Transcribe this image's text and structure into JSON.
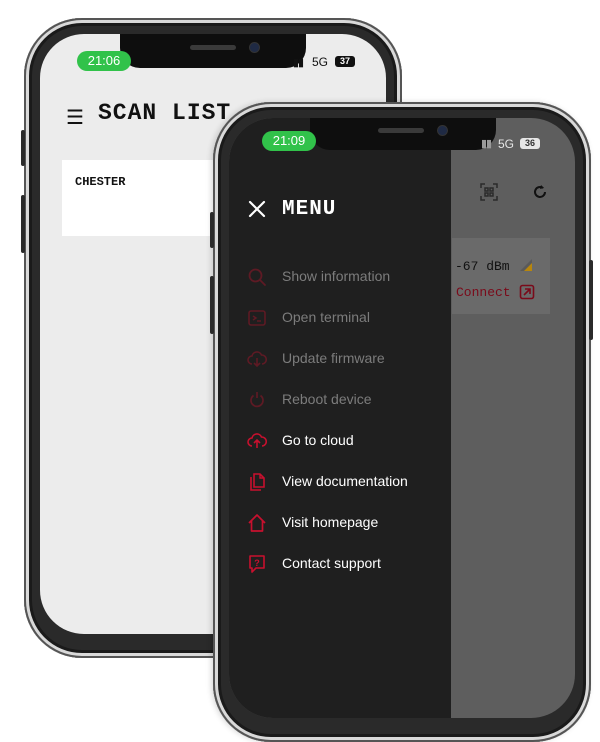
{
  "back_phone": {
    "status": {
      "time": "21:06",
      "network": "5G",
      "battery": "37"
    },
    "header": {
      "title": "SCAN LIST"
    },
    "devices": [
      {
        "name": "CHESTER"
      }
    ]
  },
  "front_phone": {
    "status": {
      "time": "21:09",
      "network": "5G",
      "battery": "36"
    },
    "menu": {
      "title": "MENU",
      "items": [
        {
          "label": "Show information",
          "icon": "search-icon",
          "enabled": false
        },
        {
          "label": "Open terminal",
          "icon": "terminal-icon",
          "enabled": false
        },
        {
          "label": "Update firmware",
          "icon": "cloud-download-icon",
          "enabled": false
        },
        {
          "label": "Reboot device",
          "icon": "power-icon",
          "enabled": false
        },
        {
          "label": "Go to cloud",
          "icon": "cloud-upload-icon",
          "enabled": true
        },
        {
          "label": "View documentation",
          "icon": "documents-icon",
          "enabled": true
        },
        {
          "label": "Visit homepage",
          "icon": "home-icon",
          "enabled": true
        },
        {
          "label": "Contact support",
          "icon": "support-chat-icon",
          "enabled": true
        }
      ]
    },
    "device_card": {
      "rssi": "-67 dBm",
      "connect_label": "Connect"
    }
  },
  "colors": {
    "accent_red": "#c8102e",
    "status_green": "#31c24a",
    "drawer_bg": "#1f1f1f",
    "disabled_text": "#7c7c7c"
  }
}
